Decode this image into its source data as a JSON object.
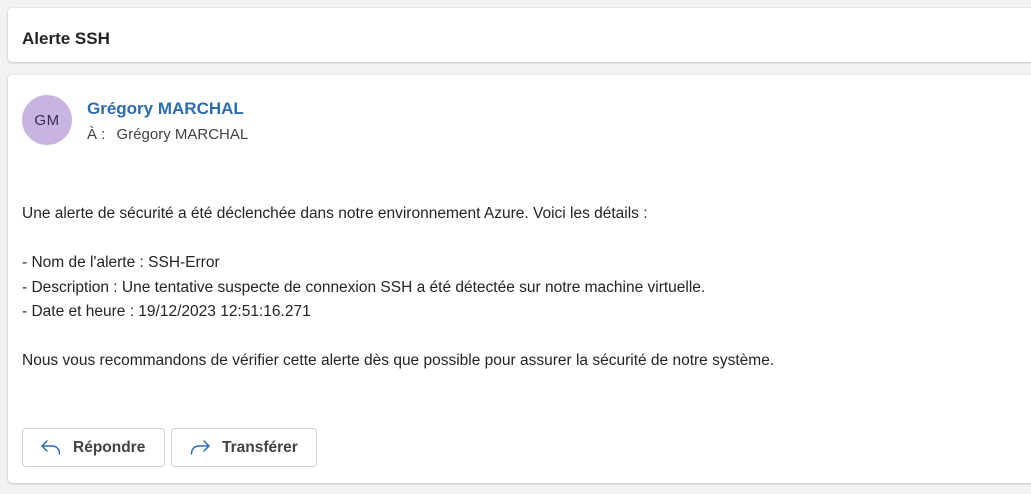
{
  "subject": {
    "title": "Alerte SSH"
  },
  "message": {
    "avatar_initials": "GM",
    "avatar_color": "#c8b4e0",
    "sender_name": "Grégory MARCHAL",
    "sender_color": "#2b6cb0",
    "to_label": "À :",
    "recipient": "Grégory MARCHAL",
    "body": {
      "intro": "Une alerte de sécurité a été déclenchée dans notre environnement Azure. Voici les détails :",
      "details": [
        "- Nom de l'alerte : SSH-Error",
        "- Description : Une tentative suspecte de connexion SSH a été détectée sur notre machine virtuelle.",
        "- Date et heure : 19/12/2023 12:51:16.271"
      ],
      "closing": "Nous vous recommandons de vérifier cette alerte dès que possible pour assurer la sécurité de notre système."
    }
  },
  "actions": {
    "reply": {
      "label": "Répondre",
      "icon": "reply-arrow-icon"
    },
    "forward": {
      "label": "Transférer",
      "icon": "forward-arrow-icon"
    }
  }
}
